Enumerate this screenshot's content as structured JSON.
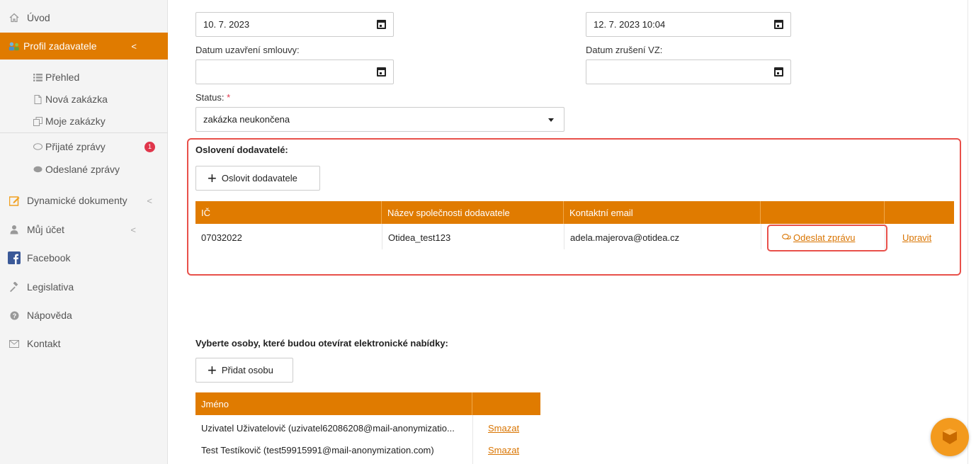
{
  "sidebar": {
    "items": [
      {
        "label": "Úvod",
        "icon": "home-icon"
      },
      {
        "label": "Profil zadavatele",
        "icon": "profile-icon"
      },
      {
        "label": "Přehled",
        "icon": "list-icon"
      },
      {
        "label": "Nová zakázka",
        "icon": "file-icon"
      },
      {
        "label": "Moje zakázky",
        "icon": "copy-icon"
      },
      {
        "label": "Přijaté zprávy",
        "icon": "comment-outline-icon",
        "badge": "1"
      },
      {
        "label": "Odeslané zprávy",
        "icon": "comment-icon"
      },
      {
        "label": "Dynamické dokumenty",
        "icon": "edit-icon"
      },
      {
        "label": "Můj účet",
        "icon": "user-icon"
      },
      {
        "label": "Facebook",
        "icon": "facebook-icon"
      },
      {
        "label": "Legislativa",
        "icon": "gavel-icon"
      },
      {
        "label": "Nápověda",
        "icon": "help-icon"
      },
      {
        "label": "Kontakt",
        "icon": "envelope-icon"
      }
    ],
    "chevron": "<"
  },
  "form": {
    "date1_value": "10. 7. 2023",
    "date2_value": "12. 7. 2023 10:04",
    "contract_label": "Datum uzavření smlouvy:",
    "contract_value": "",
    "cancel_label": "Datum zrušení VZ:",
    "cancel_value": "",
    "status_label": "Status:",
    "required_mark": "*",
    "status_value": "zakázka neukončena"
  },
  "suppliers": {
    "title": "Oslovení dodavatelé:",
    "add_button": "Oslovit dodavatele",
    "columns": [
      "IČ",
      "Název společnosti dodavatele",
      "Kontaktní email",
      "",
      ""
    ],
    "rows": [
      {
        "ic": "07032022",
        "company": "Otidea_test123",
        "email": "adela.majerova@otidea.cz",
        "message_action": "Odeslat zprávu",
        "edit_action": "Upravit"
      }
    ]
  },
  "openers": {
    "title": "Vyberte osoby, které budou otevírat elektronické nabídky:",
    "add_button": "Přidat osobu",
    "columns": [
      "Jméno",
      ""
    ],
    "rows": [
      {
        "name": "Uzivatel Uživatelovič (uzivatel62086208@mail-anonymizatio...",
        "action": "Smazat"
      },
      {
        "name": "Test Testíkovič (test59915991@mail-anonymization.com)",
        "action": "Smazat"
      }
    ]
  },
  "colors": {
    "accent": "#e07b00",
    "highlight": "#e8504a",
    "badge": "#e0364b"
  }
}
